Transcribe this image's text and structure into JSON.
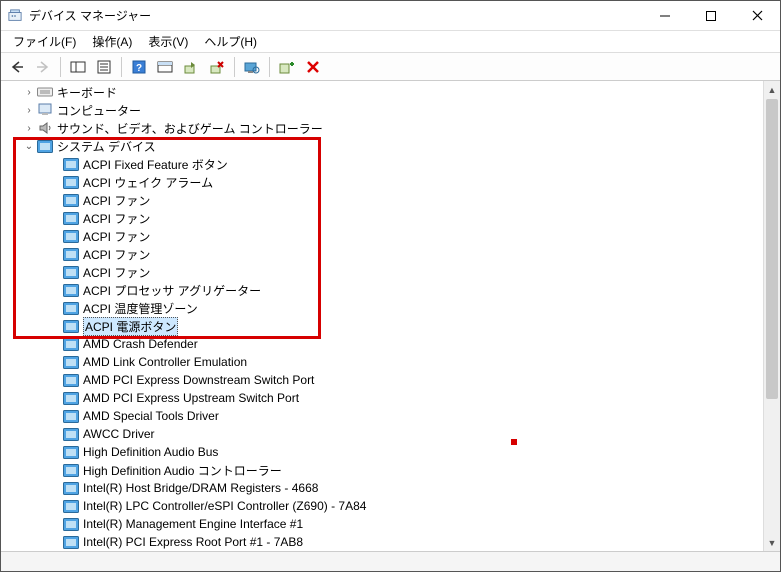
{
  "window": {
    "title": "デバイス マネージャー"
  },
  "menu": {
    "file": "ファイル(F)",
    "action": "操作(A)",
    "view": "表示(V)",
    "help": "ヘルプ(H)"
  },
  "categories": {
    "keyboard": "キーボード",
    "computer": "コンピューター",
    "sound": "サウンド、ビデオ、およびゲーム コントローラー",
    "system": "システム デバイス"
  },
  "devices": {
    "d0": "ACPI Fixed Feature ボタン",
    "d1": "ACPI ウェイク アラーム",
    "d2": "ACPI ファン",
    "d3": "ACPI ファン",
    "d4": "ACPI ファン",
    "d5": "ACPI ファン",
    "d6": "ACPI ファン",
    "d7": "ACPI プロセッサ アグリゲーター",
    "d8": "ACPI 温度管理ゾーン",
    "d9": "ACPI 電源ボタン",
    "d10": "AMD Crash Defender",
    "d11": "AMD Link Controller Emulation",
    "d12": "AMD PCI Express Downstream Switch Port",
    "d13": "AMD PCI Express Upstream Switch Port",
    "d14": "AMD Special Tools Driver",
    "d15": "AWCC Driver",
    "d16": "High Definition Audio Bus",
    "d17": "High Definition Audio コントローラー",
    "d18": "Intel(R) Host Bridge/DRAM Registers - 4668",
    "d19": "Intel(R) LPC Controller/eSPI Controller (Z690) - 7A84",
    "d20": "Intel(R) Management Engine Interface #1",
    "d21": "Intel(R) PCI Express Root Port #1 - 7AB8"
  }
}
